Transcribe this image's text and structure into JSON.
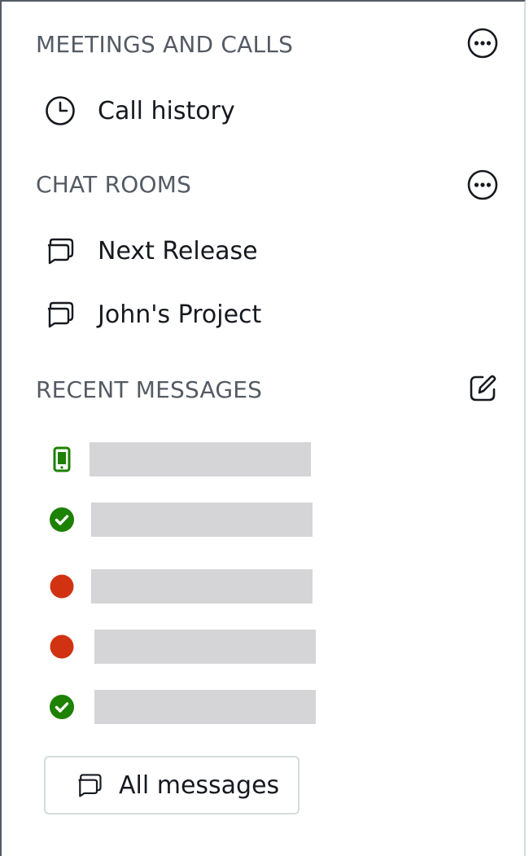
{
  "sections": {
    "meetings": {
      "header": "MEETINGS AND CALLS",
      "action_icon": "more-icon"
    },
    "chat_rooms": {
      "header": "CHAT ROOMS",
      "action_icon": "more-icon"
    },
    "recent": {
      "header": "RECENT MESSAGES",
      "action_icon": "compose-icon"
    }
  },
  "meetings_items": [
    {
      "label": "Call history",
      "icon": "clock-icon"
    }
  ],
  "chat_room_items": [
    {
      "label": "Next Release",
      "icon": "chat-bubble-icon"
    },
    {
      "label": "John's Project",
      "icon": "chat-bubble-icon"
    }
  ],
  "recent_messages": [
    {
      "status": "mobile",
      "status_color": "#1d8102"
    },
    {
      "status": "available",
      "status_color": "#1d8102"
    },
    {
      "status": "busy",
      "status_color": "#d13212"
    },
    {
      "status": "busy",
      "status_color": "#d13212"
    },
    {
      "status": "available",
      "status_color": "#1d8102"
    }
  ],
  "all_messages_button": {
    "label": "All messages",
    "icon": "chat-bubble-icon"
  },
  "colors": {
    "header_text": "#545b64",
    "available": "#1d8102",
    "busy": "#d13212",
    "placeholder_bar": "#d5d5d7"
  }
}
